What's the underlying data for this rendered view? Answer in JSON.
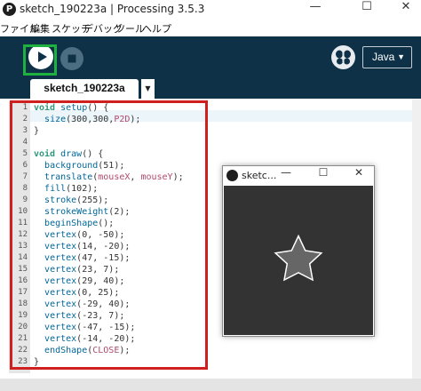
{
  "window": {
    "title": "sketch_190223a | Processing 3.5.3",
    "app_icon_glyph": "P",
    "controls": {
      "minimize": "—",
      "maximize": "☐",
      "close": "✕"
    }
  },
  "menu": [
    "ファイル",
    "編集",
    "スケッチ",
    "デバッグ",
    "ツール",
    "ヘルプ"
  ],
  "toolbar": {
    "run_icon": "play-icon",
    "stop_icon": "stop-icon",
    "debug_icon": "butterfly-icon",
    "mode": "Java",
    "mode_arrow": "▼"
  },
  "tabs": [
    {
      "label": "sketch_190223a"
    }
  ],
  "tab_menu_arrow": "▼",
  "editor": {
    "current_line": 2,
    "lines": [
      [
        [
          "kw",
          "void "
        ],
        [
          "fn",
          "setup"
        ],
        [
          "p",
          "() {"
        ]
      ],
      [
        [
          "p",
          "  "
        ],
        [
          "fn",
          "size"
        ],
        [
          "p",
          "(300,300,"
        ],
        [
          "c",
          "P2D"
        ],
        [
          "p",
          ");"
        ]
      ],
      [
        [
          "p",
          "}"
        ]
      ],
      [
        [
          "p",
          ""
        ]
      ],
      [
        [
          "kw",
          "void "
        ],
        [
          "fn",
          "draw"
        ],
        [
          "p",
          "() {"
        ]
      ],
      [
        [
          "p",
          "  "
        ],
        [
          "fn",
          "background"
        ],
        [
          "p",
          "(51);"
        ]
      ],
      [
        [
          "p",
          "  "
        ],
        [
          "fn",
          "translate"
        ],
        [
          "p",
          "("
        ],
        [
          "c",
          "mouseX"
        ],
        [
          "p",
          ", "
        ],
        [
          "c",
          "mouseY"
        ],
        [
          "p",
          ");"
        ]
      ],
      [
        [
          "p",
          "  "
        ],
        [
          "fn",
          "fill"
        ],
        [
          "p",
          "(102);"
        ]
      ],
      [
        [
          "p",
          "  "
        ],
        [
          "fn",
          "stroke"
        ],
        [
          "p",
          "(255);"
        ]
      ],
      [
        [
          "p",
          "  "
        ],
        [
          "fn",
          "strokeWeight"
        ],
        [
          "p",
          "(2);"
        ]
      ],
      [
        [
          "p",
          "  "
        ],
        [
          "fn",
          "beginShape"
        ],
        [
          "p",
          "();"
        ]
      ],
      [
        [
          "p",
          "  "
        ],
        [
          "fn",
          "vertex"
        ],
        [
          "p",
          "(0, -50);"
        ]
      ],
      [
        [
          "p",
          "  "
        ],
        [
          "fn",
          "vertex"
        ],
        [
          "p",
          "(14, -20);"
        ]
      ],
      [
        [
          "p",
          "  "
        ],
        [
          "fn",
          "vertex"
        ],
        [
          "p",
          "(47, -15);"
        ]
      ],
      [
        [
          "p",
          "  "
        ],
        [
          "fn",
          "vertex"
        ],
        [
          "p",
          "(23, 7);"
        ]
      ],
      [
        [
          "p",
          "  "
        ],
        [
          "fn",
          "vertex"
        ],
        [
          "p",
          "(29, 40);"
        ]
      ],
      [
        [
          "p",
          "  "
        ],
        [
          "fn",
          "vertex"
        ],
        [
          "p",
          "(0, 25);"
        ]
      ],
      [
        [
          "p",
          "  "
        ],
        [
          "fn",
          "vertex"
        ],
        [
          "p",
          "(-29, 40);"
        ]
      ],
      [
        [
          "p",
          "  "
        ],
        [
          "fn",
          "vertex"
        ],
        [
          "p",
          "(-23, 7);"
        ]
      ],
      [
        [
          "p",
          "  "
        ],
        [
          "fn",
          "vertex"
        ],
        [
          "p",
          "(-47, -15);"
        ]
      ],
      [
        [
          "p",
          "  "
        ],
        [
          "fn",
          "vertex"
        ],
        [
          "p",
          "(-14, -20);"
        ]
      ],
      [
        [
          "p",
          "  "
        ],
        [
          "fn",
          "endShape"
        ],
        [
          "p",
          "("
        ],
        [
          "c",
          "CLOSE"
        ],
        [
          "p",
          ");"
        ]
      ],
      [
        [
          "p",
          "}"
        ]
      ]
    ]
  },
  "sketch_window": {
    "title": "sketc...",
    "controls": {
      "minimize": "—",
      "maximize": "☐",
      "close": "✕"
    },
    "canvas_background": "#333333",
    "star_fill": "#666666",
    "star_stroke": "#ffffff",
    "star_vertices": [
      [
        0,
        -50
      ],
      [
        14,
        -20
      ],
      [
        47,
        -15
      ],
      [
        23,
        7
      ],
      [
        29,
        40
      ],
      [
        0,
        25
      ],
      [
        -29,
        40
      ],
      [
        -23,
        7
      ],
      [
        -47,
        -15
      ],
      [
        -14,
        -20
      ]
    ]
  },
  "colors": {
    "toolbar_bg": "#0e3148",
    "run_highlight": "#1fb13f",
    "code_highlight": "#d01f1f",
    "keyword": "#33997e",
    "function": "#006699",
    "constant": "#b04a6e"
  }
}
